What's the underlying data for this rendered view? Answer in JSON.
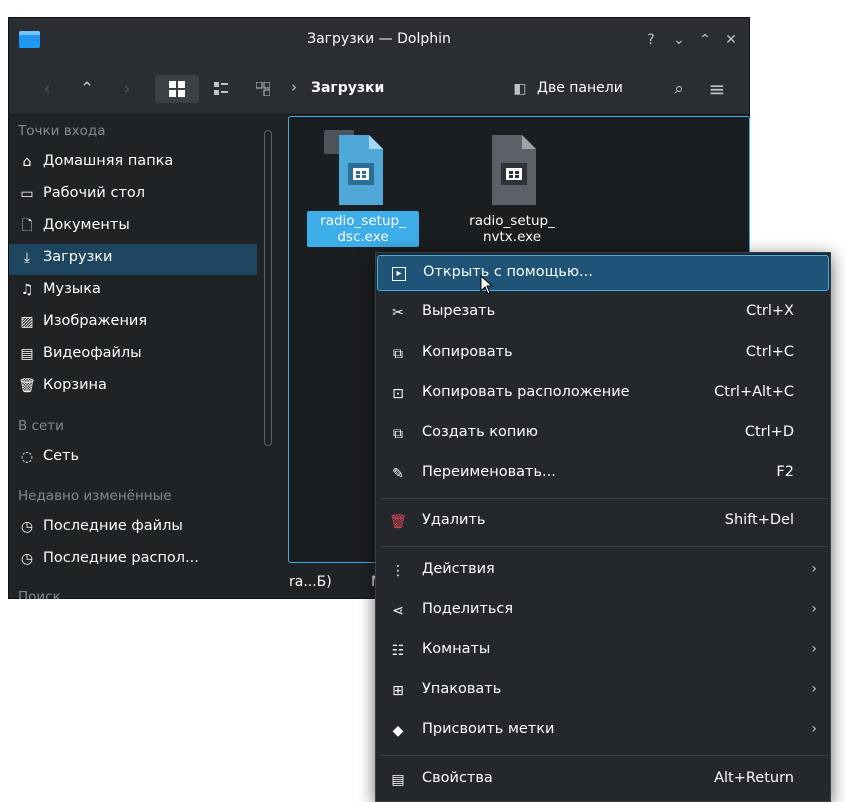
{
  "window": {
    "title": "Загрузки — Dolphin",
    "controls": [
      "?",
      "⌄",
      "⌃",
      "✕"
    ]
  },
  "toolbar": {
    "breadcrumb_sep": "›",
    "breadcrumb_current": "Загрузки",
    "split_label": "Две панели"
  },
  "sidebar": {
    "sections": [
      "Точки входа",
      "В сети",
      "Недавно изменённые",
      "Поиск"
    ],
    "items": [
      {
        "label": "Домашняя папка",
        "icon": "home-icon",
        "glyph": "⌂"
      },
      {
        "label": "Рабочий стол",
        "icon": "desktop-icon",
        "glyph": "▭"
      },
      {
        "label": "Документы",
        "icon": "documents-icon",
        "glyph": "🗋"
      },
      {
        "label": "Загрузки",
        "icon": "downloads-icon",
        "glyph": "⤓"
      },
      {
        "label": "Музыка",
        "icon": "music-icon",
        "glyph": "♫"
      },
      {
        "label": "Изображения",
        "icon": "pictures-icon",
        "glyph": "▨"
      },
      {
        "label": "Видеофайлы",
        "icon": "videos-icon",
        "glyph": "▤"
      },
      {
        "label": "Корзина",
        "icon": "trash-icon",
        "glyph": "🗑"
      },
      {
        "label": "Сеть",
        "icon": "network-icon",
        "glyph": "◌"
      },
      {
        "label": "Последние файлы",
        "icon": "recent-files-icon",
        "glyph": "◷"
      },
      {
        "label": "Последние распол...",
        "icon": "recent-locations-icon",
        "glyph": "◷"
      }
    ]
  },
  "files": [
    {
      "line1": "radio_setup_",
      "line2": "dsc.exe"
    },
    {
      "line1": "radio_setup_",
      "line2": "nvtx.exe"
    }
  ],
  "status": {
    "left": "ra...Б)",
    "right": "М"
  },
  "menu": {
    "items": [
      {
        "label": "Открыть с помощью...",
        "icon": "open-with-icon",
        "glyph": "▸"
      },
      {
        "label": "Вырезать",
        "shortcut": "Ctrl+X",
        "icon": "cut-icon",
        "glyph": "✂"
      },
      {
        "label": "Копировать",
        "shortcut": "Ctrl+C",
        "icon": "copy-icon",
        "glyph": "⧉"
      },
      {
        "label": "Копировать расположение",
        "shortcut": "Ctrl+Alt+C",
        "icon": "copy-location-icon",
        "glyph": "⊡"
      },
      {
        "label": "Создать копию",
        "shortcut": "Ctrl+D",
        "icon": "duplicate-icon",
        "glyph": "⧉"
      },
      {
        "label": "Переименовать...",
        "shortcut": "F2",
        "icon": "rename-icon",
        "glyph": "✎"
      },
      {
        "label": "Удалить",
        "shortcut": "Shift+Del",
        "icon": "delete-icon",
        "glyph": "🗑"
      },
      {
        "label": "Действия",
        "arrow": "›",
        "icon": "actions-icon",
        "glyph": "⋮"
      },
      {
        "label": "Поделиться",
        "arrow": "›",
        "icon": "share-icon",
        "glyph": "⋖"
      },
      {
        "label": "Комнаты",
        "arrow": "›",
        "icon": "activities-icon",
        "glyph": "☷"
      },
      {
        "label": "Упаковать",
        "arrow": "›",
        "icon": "compress-icon",
        "glyph": "⊞"
      },
      {
        "label": "Присвоить метки",
        "arrow": "›",
        "icon": "tag-icon",
        "glyph": "◆"
      },
      {
        "label": "Свойства",
        "shortcut": "Alt+Return",
        "icon": "properties-icon",
        "glyph": "▤"
      }
    ]
  },
  "colors": {
    "accent": "#3daee9",
    "selection": "#1e4560",
    "delete_icon": "#da4453"
  }
}
